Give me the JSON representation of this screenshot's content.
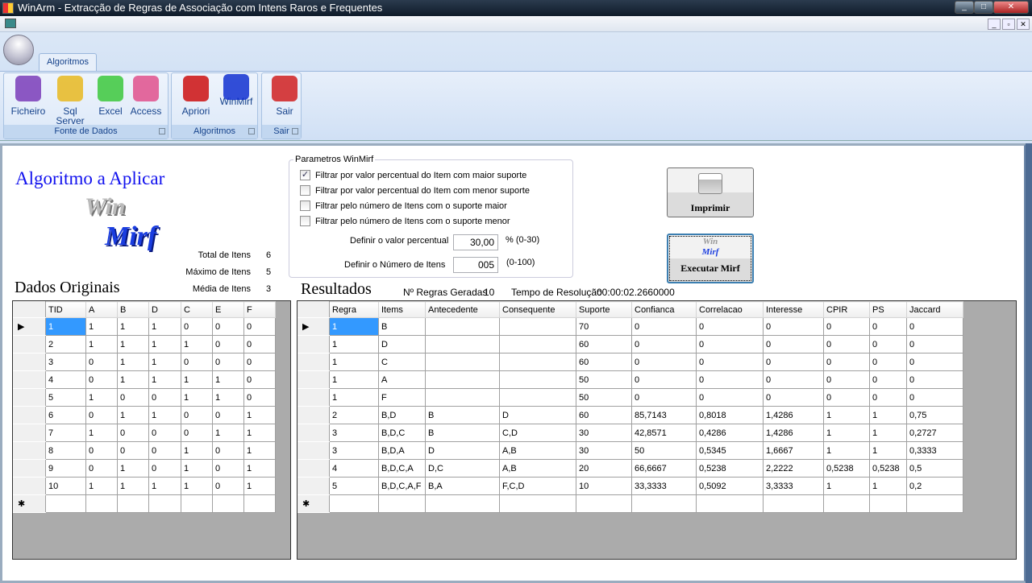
{
  "window": {
    "title": "WinArm - Extracção de Regras de Associação com Intens Raros e Frequentes"
  },
  "ribbon": {
    "tab": "Algoritmos",
    "groups": [
      {
        "label": "Fonte de Dados",
        "buttons": [
          {
            "label": "Ficheiro",
            "icon": "ficheiro-icon",
            "color": "#7a3cb8"
          },
          {
            "label": "Sql Server",
            "icon": "sql-server-icon",
            "color": "#e8b820"
          },
          {
            "label": "Excel",
            "icon": "excel-icon",
            "color": "#3cc83c"
          },
          {
            "label": "Access",
            "icon": "access-icon",
            "color": "#e0508c"
          }
        ]
      },
      {
        "label": "Algoritmos",
        "buttons": [
          {
            "label": "Apriori",
            "icon": "apriori-icon",
            "color": "#cc1010"
          },
          {
            "label": "WinMirf",
            "icon": "winmirf-icon",
            "color": "#1030d0"
          }
        ]
      },
      {
        "label": "Sair",
        "buttons": [
          {
            "label": "Sair",
            "icon": "exit-icon",
            "color": "#d02020"
          }
        ]
      }
    ]
  },
  "main": {
    "algo_title": "Algoritmo a Aplicar",
    "logo_text": "WinMirf",
    "stats": [
      {
        "label": "Total de Itens",
        "value": "6"
      },
      {
        "label": "Máximo de Itens",
        "value": "5"
      },
      {
        "label": "Média de Itens",
        "value": "3"
      }
    ],
    "params": {
      "legend": "Parametros WinMirf",
      "checks": [
        {
          "label": "Filtrar por valor percentual do Item com maior suporte",
          "checked": true
        },
        {
          "label": "Filtrar por valor percentual do Item com menor suporte",
          "checked": false
        },
        {
          "label": "Filtrar pelo número de Itens com o suporte maior",
          "checked": false
        },
        {
          "label": "Filtrar pelo número de Itens com o suporte menor",
          "checked": false
        }
      ],
      "percent_label": "Definir o valor percentual",
      "percent_value": "30,00",
      "percent_range": "% (0-30)",
      "count_label": "Definir o Número de Itens",
      "count_value": "005",
      "count_range": "(0-100)"
    },
    "print_button": "Imprimir",
    "run_button": "Executar Mirf",
    "original_title": "Dados Originais",
    "results_title": "Resultados",
    "rules_label": "Nº Regras Geradas",
    "rules_value": "10",
    "time_label": "Tempo de Resolução",
    "time_value": "00:00:02.2660000"
  },
  "original_table": {
    "columns": [
      "TID",
      "A",
      "B",
      "D",
      "C",
      "E",
      "F"
    ],
    "rows": [
      [
        "1",
        "1",
        "1",
        "1",
        "0",
        "0",
        "0"
      ],
      [
        "2",
        "1",
        "1",
        "1",
        "1",
        "0",
        "0"
      ],
      [
        "3",
        "0",
        "1",
        "1",
        "0",
        "0",
        "0"
      ],
      [
        "4",
        "0",
        "1",
        "1",
        "1",
        "1",
        "0"
      ],
      [
        "5",
        "1",
        "0",
        "0",
        "1",
        "1",
        "0"
      ],
      [
        "6",
        "0",
        "1",
        "1",
        "0",
        "0",
        "1"
      ],
      [
        "7",
        "1",
        "0",
        "0",
        "0",
        "1",
        "1"
      ],
      [
        "8",
        "0",
        "0",
        "0",
        "1",
        "0",
        "1"
      ],
      [
        "9",
        "0",
        "1",
        "0",
        "1",
        "0",
        "1"
      ],
      [
        "10",
        "1",
        "1",
        "1",
        "1",
        "0",
        "1"
      ]
    ]
  },
  "results_table": {
    "columns": [
      "Regra",
      "Items",
      "Antecedente",
      "Consequente",
      "Suporte",
      "Confianca",
      "Correlacao",
      "Interesse",
      "CPIR",
      "PS",
      "Jaccard"
    ],
    "rows": [
      [
        "1",
        "B",
        "",
        "",
        "70",
        "0",
        "0",
        "0",
        "0",
        "0",
        "0"
      ],
      [
        "1",
        "D",
        "",
        "",
        "60",
        "0",
        "0",
        "0",
        "0",
        "0",
        "0"
      ],
      [
        "1",
        "C",
        "",
        "",
        "60",
        "0",
        "0",
        "0",
        "0",
        "0",
        "0"
      ],
      [
        "1",
        "A",
        "",
        "",
        "50",
        "0",
        "0",
        "0",
        "0",
        "0",
        "0"
      ],
      [
        "1",
        "F",
        "",
        "",
        "50",
        "0",
        "0",
        "0",
        "0",
        "0",
        "0"
      ],
      [
        "2",
        "B,D",
        "B",
        "D",
        "60",
        "85,7143",
        "0,8018",
        "1,4286",
        "1",
        "1",
        "0,75"
      ],
      [
        "3",
        "B,D,C",
        "B",
        "C,D",
        "30",
        "42,8571",
        "0,4286",
        "1,4286",
        "1",
        "1",
        "0,2727"
      ],
      [
        "3",
        "B,D,A",
        "D",
        "A,B",
        "30",
        "50",
        "0,5345",
        "1,6667",
        "1",
        "1",
        "0,3333"
      ],
      [
        "4",
        "B,D,C,A",
        "D,C",
        "A,B",
        "20",
        "66,6667",
        "0,5238",
        "2,2222",
        "0,5238",
        "0,5238",
        "0,5"
      ],
      [
        "5",
        "B,D,C,A,F",
        "B,A",
        "F,C,D",
        "10",
        "33,3333",
        "0,5092",
        "3,3333",
        "1",
        "1",
        "0,2"
      ]
    ]
  }
}
